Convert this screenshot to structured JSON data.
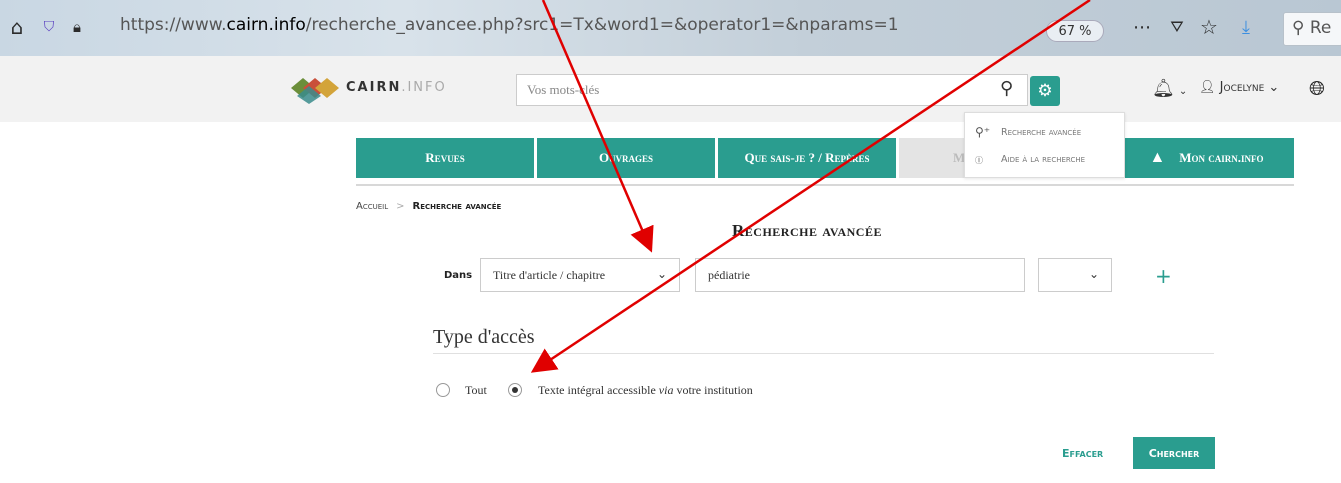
{
  "browser": {
    "url_prefix": "https://www.",
    "url_domain": "cairn.info",
    "url_suffix": "/recherche_avancee.php?src1=Tx&word1=&operator1=&nparams=1",
    "zoom": "67 %",
    "search_partial": "Re"
  },
  "header": {
    "logo_bold": "CAIRN",
    "logo_light": ".INFO",
    "search_placeholder": "Vos mots-clés",
    "user_name": "Jocelyne"
  },
  "nav": {
    "tabs": [
      "Revues",
      "Ouvrages",
      "Que sais-je ? / Repères",
      "M",
      "Mon cairn.info"
    ]
  },
  "menu": {
    "items": [
      "Recherche avancée",
      "Aide à la recherche"
    ]
  },
  "breadcrumb": {
    "home": "Accueil",
    "current": "Recherche avancée"
  },
  "page": {
    "title": "Recherche avancée",
    "dans_label": "Dans",
    "field_select": "Titre d'article / chapitre",
    "query_value": "pédiatrie",
    "access_title": "Type d'accès",
    "radio_all": "Tout",
    "radio_institution_pre": "Texte intégral accessible ",
    "radio_institution_em": "via",
    "radio_institution_post": " votre institution",
    "clear_label": "Effacer",
    "search_label": "Chercher"
  },
  "colors": {
    "accent": "#2a9d8f",
    "annotation_arrow": "#e00000"
  }
}
